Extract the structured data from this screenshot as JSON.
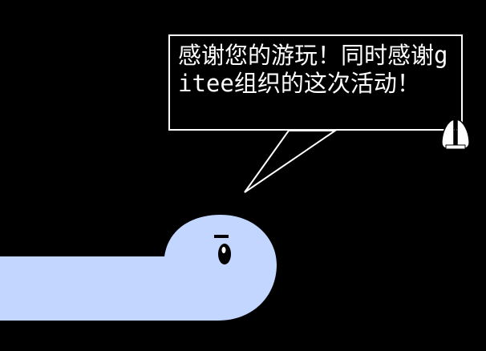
{
  "scene": {
    "background_color": "#000000",
    "creature_color": "#c2d6ff",
    "outline_color": "#ffffff"
  },
  "dialog": {
    "text": "感谢您的游玩！同时感谢gitee组织的这次活动！",
    "text_color": "#ffffff",
    "border_color": "#ffffff"
  },
  "icons": {
    "continue_indicator": "lungs-icon",
    "character": "snake-creature-icon"
  }
}
